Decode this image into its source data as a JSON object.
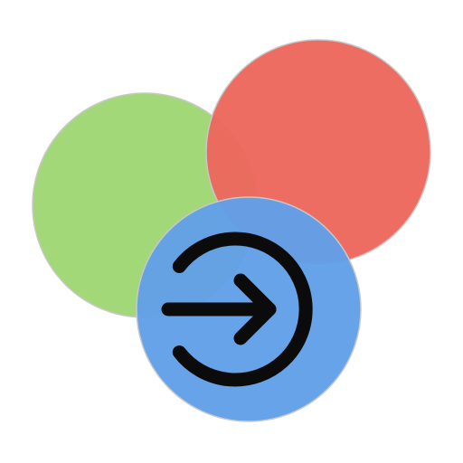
{
  "icon": {
    "name": "login-icon",
    "circles": [
      {
        "name": "green-circle",
        "color": "#9fd672"
      },
      {
        "name": "red-circle",
        "color": "#ec675d"
      },
      {
        "name": "blue-circle",
        "color": "#619fe8"
      }
    ],
    "glyph": {
      "name": "enter-arrow-glyph",
      "color": "#0b0b0b"
    },
    "outline_color": "#c8c8c8"
  }
}
